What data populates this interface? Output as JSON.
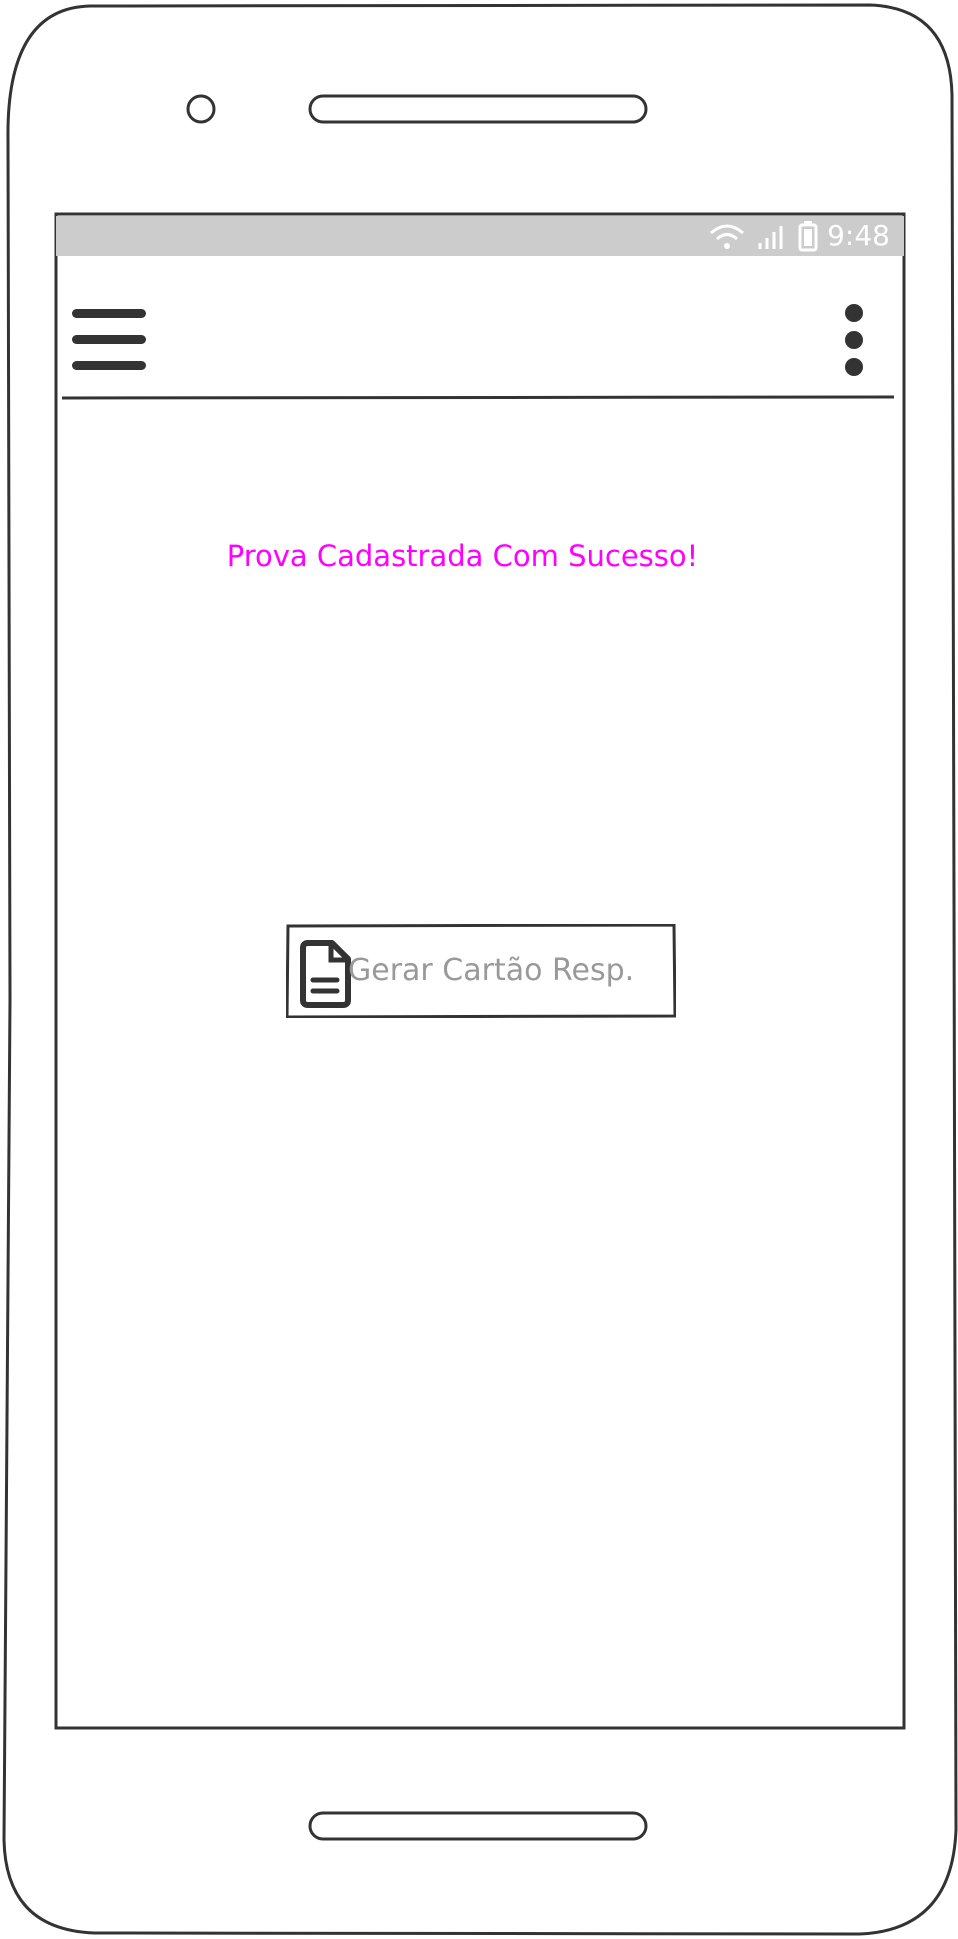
{
  "status_bar": {
    "time": "9:48",
    "icons": [
      "wifi-icon",
      "signal-icon",
      "battery-icon"
    ]
  },
  "app_bar": {
    "icons": [
      "menu-icon",
      "more-vertical-icon"
    ]
  },
  "main": {
    "message": "Prova Cadastrada Com Sucesso!",
    "button_label": "Gerar Cartão Resp.",
    "button_icon": "document-icon"
  },
  "colors": {
    "message": "#ff00ff",
    "button_text": "#999999",
    "status_bar": "#cccccc",
    "stroke": "#333333"
  }
}
